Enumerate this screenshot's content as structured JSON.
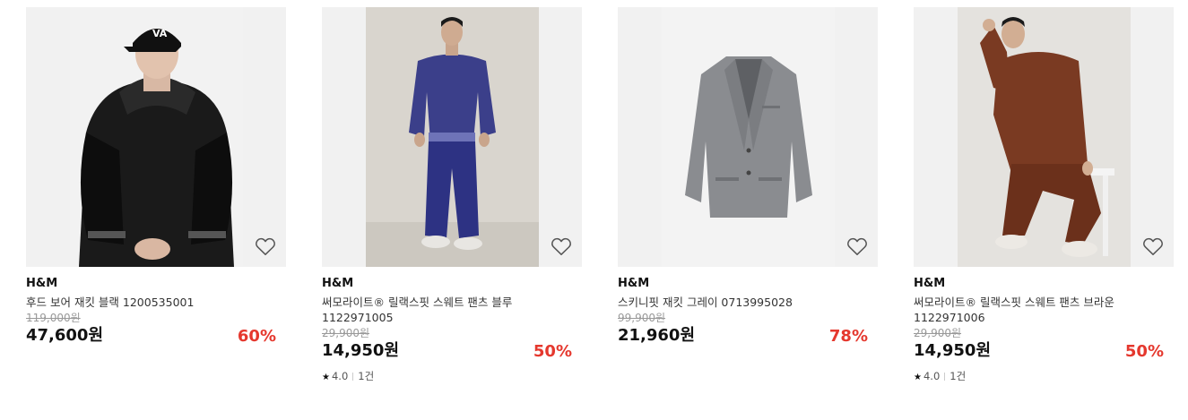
{
  "products": [
    {
      "image": "model-black-varsity-jacket-photo",
      "brand": "H&M",
      "title": "후드 보어 재킷 블랙 1200535001",
      "original_price": "119,000원",
      "price": "47,600원",
      "discount": "60%",
      "rating": null,
      "review_count": null
    },
    {
      "image": "model-blue-sweat-set-photo",
      "brand": "H&M",
      "title": "써모라이트® 릴랙스핏 스웨트 팬츠 블루 1122971005",
      "original_price": "29,900원",
      "price": "14,950원",
      "discount": "50%",
      "rating": "4.0",
      "review_count": "1건"
    },
    {
      "image": "grey-blazer-photo",
      "brand": "H&M",
      "title": "스키니핏 재킷 그레이 0713995028",
      "original_price": "99,900원",
      "price": "21,960원",
      "discount": "78%",
      "rating": null,
      "review_count": null
    },
    {
      "image": "model-brown-knit-set-photo",
      "brand": "H&M",
      "title": "써모라이트® 릴랙스핏 스웨트 팬츠 브라운 1122971006",
      "original_price": "29,900원",
      "price": "14,950원",
      "discount": "50%",
      "rating": "4.0",
      "review_count": "1건"
    }
  ],
  "icons": {
    "wishlist": "heart-outline-icon",
    "rating": "star-icon"
  },
  "colors": {
    "discount": "#e5382e",
    "background_tile": "#f1f1f1"
  }
}
